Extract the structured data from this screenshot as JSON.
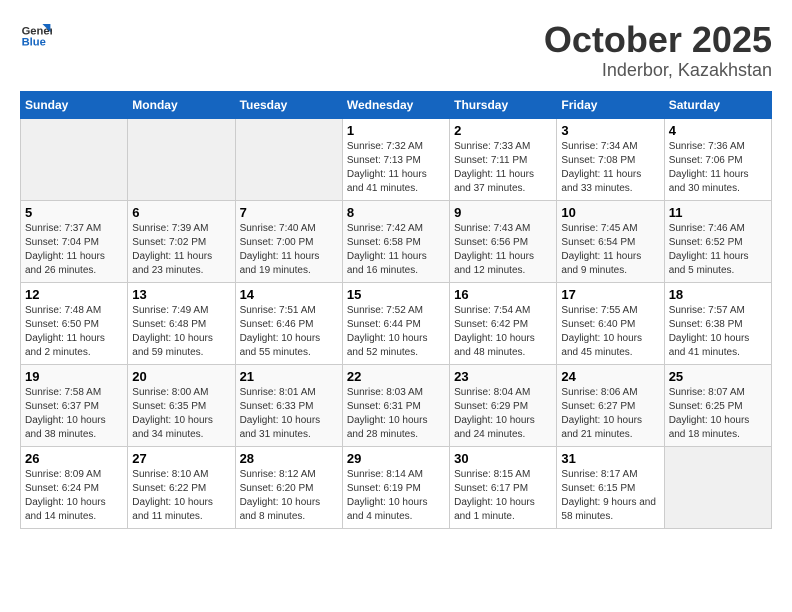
{
  "header": {
    "logo_general": "General",
    "logo_blue": "Blue",
    "month": "October 2025",
    "location": "Inderbor, Kazakhstan"
  },
  "weekdays": [
    "Sunday",
    "Monday",
    "Tuesday",
    "Wednesday",
    "Thursday",
    "Friday",
    "Saturday"
  ],
  "weeks": [
    [
      {
        "day": "",
        "sunrise": "",
        "sunset": "",
        "daylight": "",
        "empty": true
      },
      {
        "day": "",
        "sunrise": "",
        "sunset": "",
        "daylight": "",
        "empty": true
      },
      {
        "day": "",
        "sunrise": "",
        "sunset": "",
        "daylight": "",
        "empty": true
      },
      {
        "day": "1",
        "sunrise": "Sunrise: 7:32 AM",
        "sunset": "Sunset: 7:13 PM",
        "daylight": "Daylight: 11 hours and 41 minutes."
      },
      {
        "day": "2",
        "sunrise": "Sunrise: 7:33 AM",
        "sunset": "Sunset: 7:11 PM",
        "daylight": "Daylight: 11 hours and 37 minutes."
      },
      {
        "day": "3",
        "sunrise": "Sunrise: 7:34 AM",
        "sunset": "Sunset: 7:08 PM",
        "daylight": "Daylight: 11 hours and 33 minutes."
      },
      {
        "day": "4",
        "sunrise": "Sunrise: 7:36 AM",
        "sunset": "Sunset: 7:06 PM",
        "daylight": "Daylight: 11 hours and 30 minutes."
      }
    ],
    [
      {
        "day": "5",
        "sunrise": "Sunrise: 7:37 AM",
        "sunset": "Sunset: 7:04 PM",
        "daylight": "Daylight: 11 hours and 26 minutes."
      },
      {
        "day": "6",
        "sunrise": "Sunrise: 7:39 AM",
        "sunset": "Sunset: 7:02 PM",
        "daylight": "Daylight: 11 hours and 23 minutes."
      },
      {
        "day": "7",
        "sunrise": "Sunrise: 7:40 AM",
        "sunset": "Sunset: 7:00 PM",
        "daylight": "Daylight: 11 hours and 19 minutes."
      },
      {
        "day": "8",
        "sunrise": "Sunrise: 7:42 AM",
        "sunset": "Sunset: 6:58 PM",
        "daylight": "Daylight: 11 hours and 16 minutes."
      },
      {
        "day": "9",
        "sunrise": "Sunrise: 7:43 AM",
        "sunset": "Sunset: 6:56 PM",
        "daylight": "Daylight: 11 hours and 12 minutes."
      },
      {
        "day": "10",
        "sunrise": "Sunrise: 7:45 AM",
        "sunset": "Sunset: 6:54 PM",
        "daylight": "Daylight: 11 hours and 9 minutes."
      },
      {
        "day": "11",
        "sunrise": "Sunrise: 7:46 AM",
        "sunset": "Sunset: 6:52 PM",
        "daylight": "Daylight: 11 hours and 5 minutes."
      }
    ],
    [
      {
        "day": "12",
        "sunrise": "Sunrise: 7:48 AM",
        "sunset": "Sunset: 6:50 PM",
        "daylight": "Daylight: 11 hours and 2 minutes."
      },
      {
        "day": "13",
        "sunrise": "Sunrise: 7:49 AM",
        "sunset": "Sunset: 6:48 PM",
        "daylight": "Daylight: 10 hours and 59 minutes."
      },
      {
        "day": "14",
        "sunrise": "Sunrise: 7:51 AM",
        "sunset": "Sunset: 6:46 PM",
        "daylight": "Daylight: 10 hours and 55 minutes."
      },
      {
        "day": "15",
        "sunrise": "Sunrise: 7:52 AM",
        "sunset": "Sunset: 6:44 PM",
        "daylight": "Daylight: 10 hours and 52 minutes."
      },
      {
        "day": "16",
        "sunrise": "Sunrise: 7:54 AM",
        "sunset": "Sunset: 6:42 PM",
        "daylight": "Daylight: 10 hours and 48 minutes."
      },
      {
        "day": "17",
        "sunrise": "Sunrise: 7:55 AM",
        "sunset": "Sunset: 6:40 PM",
        "daylight": "Daylight: 10 hours and 45 minutes."
      },
      {
        "day": "18",
        "sunrise": "Sunrise: 7:57 AM",
        "sunset": "Sunset: 6:38 PM",
        "daylight": "Daylight: 10 hours and 41 minutes."
      }
    ],
    [
      {
        "day": "19",
        "sunrise": "Sunrise: 7:58 AM",
        "sunset": "Sunset: 6:37 PM",
        "daylight": "Daylight: 10 hours and 38 minutes."
      },
      {
        "day": "20",
        "sunrise": "Sunrise: 8:00 AM",
        "sunset": "Sunset: 6:35 PM",
        "daylight": "Daylight: 10 hours and 34 minutes."
      },
      {
        "day": "21",
        "sunrise": "Sunrise: 8:01 AM",
        "sunset": "Sunset: 6:33 PM",
        "daylight": "Daylight: 10 hours and 31 minutes."
      },
      {
        "day": "22",
        "sunrise": "Sunrise: 8:03 AM",
        "sunset": "Sunset: 6:31 PM",
        "daylight": "Daylight: 10 hours and 28 minutes."
      },
      {
        "day": "23",
        "sunrise": "Sunrise: 8:04 AM",
        "sunset": "Sunset: 6:29 PM",
        "daylight": "Daylight: 10 hours and 24 minutes."
      },
      {
        "day": "24",
        "sunrise": "Sunrise: 8:06 AM",
        "sunset": "Sunset: 6:27 PM",
        "daylight": "Daylight: 10 hours and 21 minutes."
      },
      {
        "day": "25",
        "sunrise": "Sunrise: 8:07 AM",
        "sunset": "Sunset: 6:25 PM",
        "daylight": "Daylight: 10 hours and 18 minutes."
      }
    ],
    [
      {
        "day": "26",
        "sunrise": "Sunrise: 8:09 AM",
        "sunset": "Sunset: 6:24 PM",
        "daylight": "Daylight: 10 hours and 14 minutes."
      },
      {
        "day": "27",
        "sunrise": "Sunrise: 8:10 AM",
        "sunset": "Sunset: 6:22 PM",
        "daylight": "Daylight: 10 hours and 11 minutes."
      },
      {
        "day": "28",
        "sunrise": "Sunrise: 8:12 AM",
        "sunset": "Sunset: 6:20 PM",
        "daylight": "Daylight: 10 hours and 8 minutes."
      },
      {
        "day": "29",
        "sunrise": "Sunrise: 8:14 AM",
        "sunset": "Sunset: 6:19 PM",
        "daylight": "Daylight: 10 hours and 4 minutes."
      },
      {
        "day": "30",
        "sunrise": "Sunrise: 8:15 AM",
        "sunset": "Sunset: 6:17 PM",
        "daylight": "Daylight: 10 hours and 1 minute."
      },
      {
        "day": "31",
        "sunrise": "Sunrise: 8:17 AM",
        "sunset": "Sunset: 6:15 PM",
        "daylight": "Daylight: 9 hours and 58 minutes."
      },
      {
        "day": "",
        "sunrise": "",
        "sunset": "",
        "daylight": "",
        "empty": true
      }
    ]
  ]
}
